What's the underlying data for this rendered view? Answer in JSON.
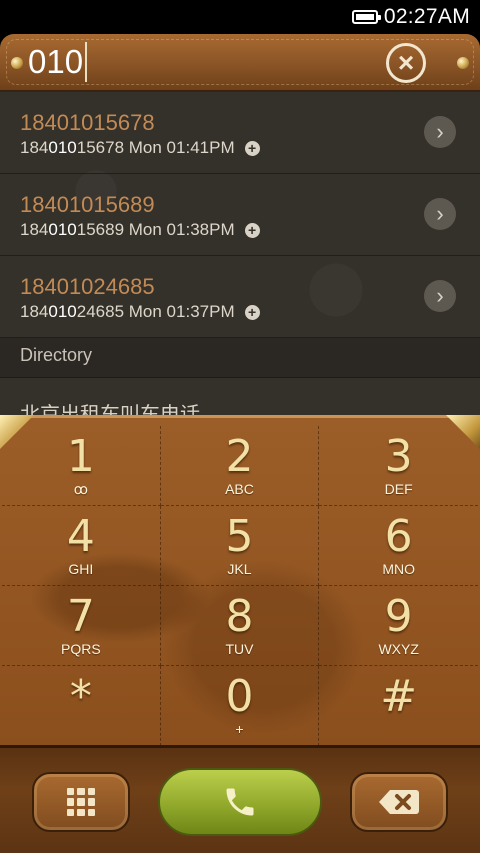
{
  "status_bar": {
    "time": "02:27AM",
    "battery_icon": "battery-full-icon"
  },
  "dial_input": {
    "value": "010",
    "clear_icon": "close-circle-icon"
  },
  "results": [
    {
      "number": "18401015678",
      "match_before": "184",
      "match": "010",
      "match_after": "15678",
      "time": "Mon 01:41PM"
    },
    {
      "number": "18401015689",
      "match_before": "184",
      "match": "010",
      "match_after": "15689",
      "time": "Mon 01:38PM"
    },
    {
      "number": "18401024685",
      "match_before": "184",
      "match": "010",
      "match_after": "24685",
      "time": "Mon 01:37PM"
    }
  ],
  "directory": {
    "label": "Directory",
    "partial_item": "北京出租车叫车电话"
  },
  "keypad": [
    {
      "digit": "1",
      "letters": ""
    },
    {
      "digit": "2",
      "letters": "ABC"
    },
    {
      "digit": "3",
      "letters": "DEF"
    },
    {
      "digit": "4",
      "letters": "GHI"
    },
    {
      "digit": "5",
      "letters": "JKL"
    },
    {
      "digit": "6",
      "letters": "MNO"
    },
    {
      "digit": "7",
      "letters": "PQRS"
    },
    {
      "digit": "8",
      "letters": "TUV"
    },
    {
      "digit": "9",
      "letters": "WXYZ"
    },
    {
      "digit": "*",
      "letters": ""
    },
    {
      "digit": "0",
      "letters": "+"
    },
    {
      "digit": "#",
      "letters": ""
    }
  ],
  "voicemail_glyph": "ꝏ",
  "bottom_bar": {
    "left_icon": "keypad-toggle-icon",
    "call_icon": "phone-call-icon",
    "right_icon": "backspace-icon"
  },
  "colors": {
    "leather": "#8b4f1d",
    "list_bg": "#34302a",
    "number_orange": "#c28b56",
    "call_green": "#8da529",
    "gold": "#f2e1a6"
  }
}
